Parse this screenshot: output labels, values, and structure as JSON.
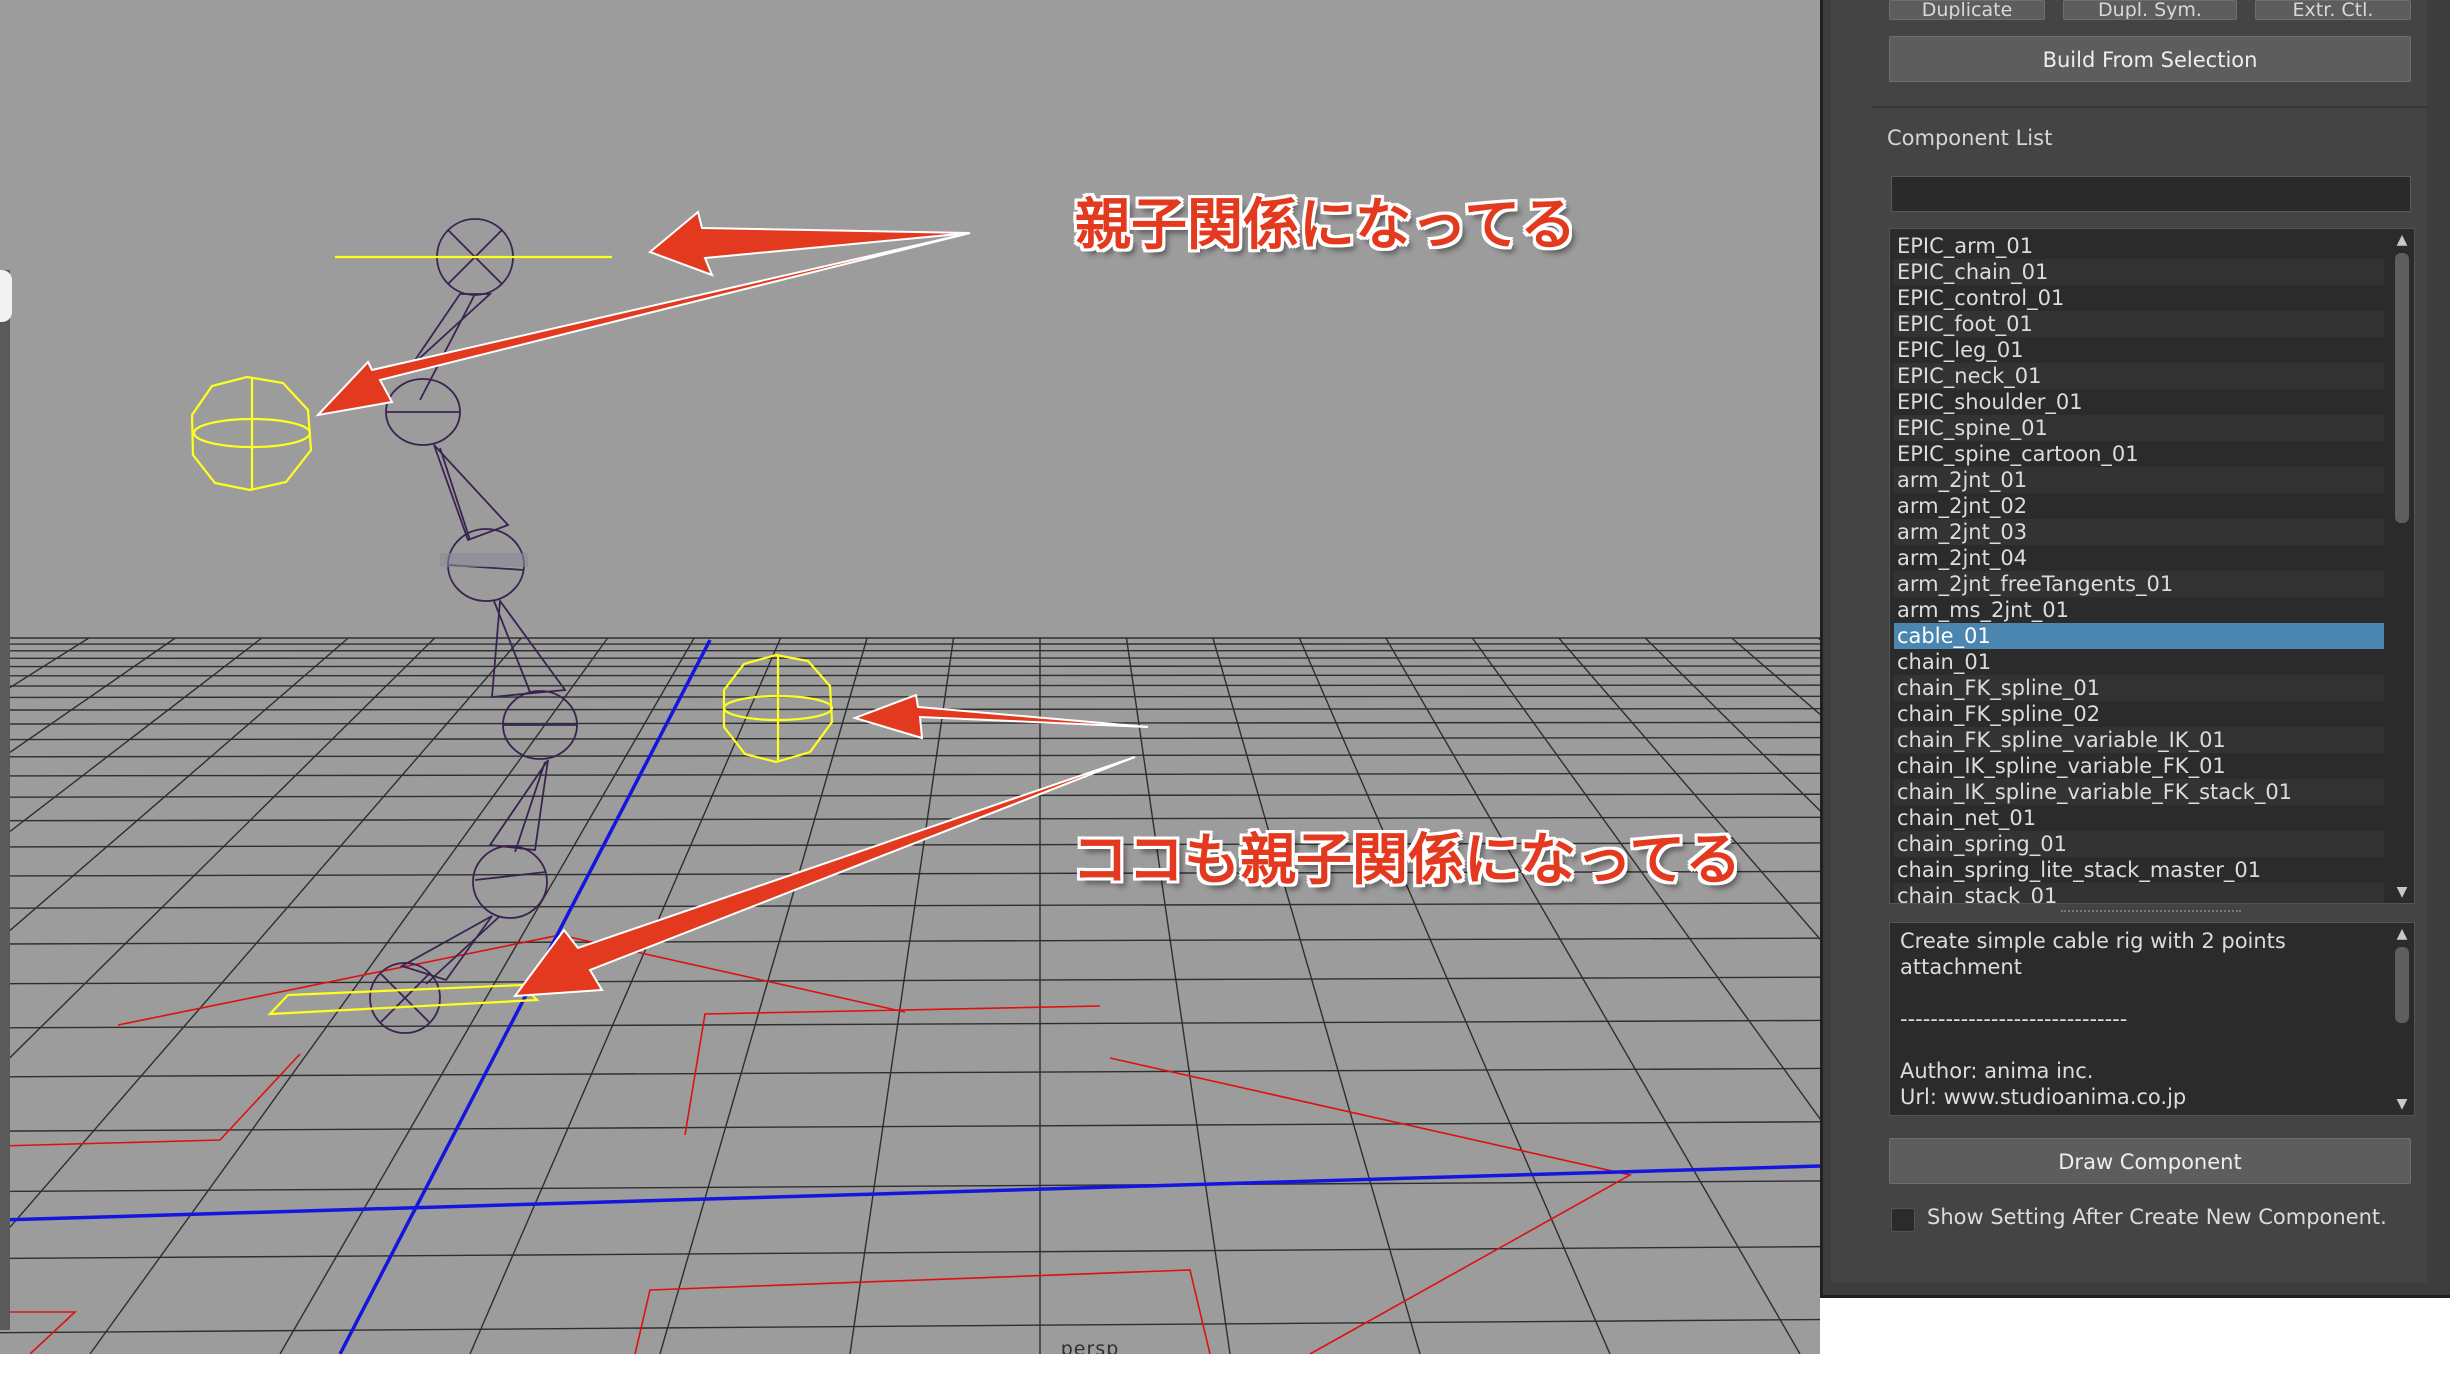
{
  "viewport": {
    "name": "persp",
    "callout_top": "親子関係になってる",
    "callout_bottom": "ココも親子関係になってる"
  },
  "panel": {
    "buttons": {
      "duplicate": "Duplicate",
      "dupli_sym": "Dupl. Sym.",
      "extr_ctl": "Extr. Ctl.",
      "build_from_selection": "Build From Selection",
      "draw_component": "Draw Component"
    },
    "component_list": {
      "label": "Component List",
      "filter_value": "",
      "items": [
        "EPIC_arm_01",
        "EPIC_chain_01",
        "EPIC_control_01",
        "EPIC_foot_01",
        "EPIC_leg_01",
        "EPIC_neck_01",
        "EPIC_shoulder_01",
        "EPIC_spine_01",
        "EPIC_spine_cartoon_01",
        "arm_2jnt_01",
        "arm_2jnt_02",
        "arm_2jnt_03",
        "arm_2jnt_04",
        "arm_2jnt_freeTangents_01",
        "arm_ms_2jnt_01",
        "cable_01",
        "chain_01",
        "chain_FK_spline_01",
        "chain_FK_spline_02",
        "chain_FK_spline_variable_IK_01",
        "chain_IK_spline_variable_FK_01",
        "chain_IK_spline_variable_FK_stack_01",
        "chain_net_01",
        "chain_spring_01",
        "chain_spring_lite_stack_master_01",
        "chain_stack_01"
      ],
      "selected": "cable_01"
    },
    "description": [
      "Create simple cable rig with 2 points",
      "attachment",
      "",
      "------------------------------",
      "",
      "Author: anima inc.",
      "Url: www.studioanima.co.jp"
    ],
    "show_setting": {
      "label": "Show Setting After Create New Component.",
      "checked": false
    }
  },
  "colors": {
    "viewport_bg": "#9c9c9c",
    "grid": "#2e2e2e",
    "axis": "#1515e0",
    "joint": "#3a2350",
    "control": "#ffff1e",
    "annotation": "#e33a1f",
    "selection": "#4a86b0"
  }
}
